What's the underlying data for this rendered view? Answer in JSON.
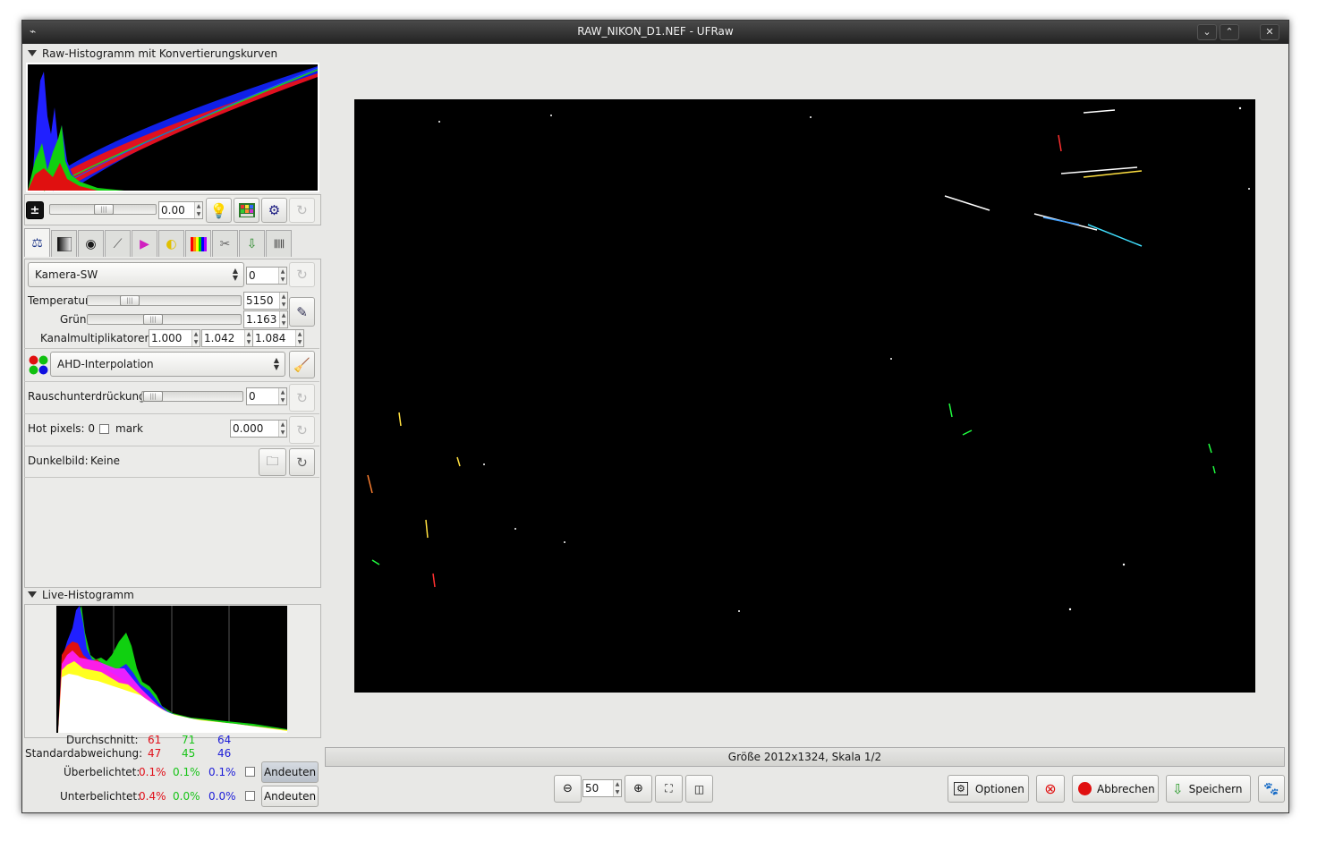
{
  "window": {
    "title": "RAW_NIKON_D1.NEF - UFRaw",
    "menu_icon": "window-menu-icon",
    "controls": [
      "minimize-icon",
      "maximize-icon",
      "close-icon"
    ],
    "minimize_glyph": "⌄",
    "maximize_glyph": "⌃",
    "close_glyph": "✕"
  },
  "raw_histogram": {
    "header": "Raw-Histogramm mit Konvertierungskurven"
  },
  "exposure": {
    "value": "0.00",
    "icon": "exposure-plus-minus-icon",
    "buttons": [
      "auto-exposure-bulb-icon",
      "color-checker-icon",
      "gear-settings-icon",
      "reset-icon"
    ]
  },
  "tabs": [
    {
      "name": "tab-white-balance",
      "icon": "white-balance-icon"
    },
    {
      "name": "tab-grayscale",
      "icon": "grayscale-icon"
    },
    {
      "name": "tab-lens",
      "icon": "lens-icon"
    },
    {
      "name": "tab-base-curve",
      "icon": "base-curve-icon"
    },
    {
      "name": "tab-color-management",
      "icon": "color-management-icon"
    },
    {
      "name": "tab-corrections",
      "icon": "corrections-icon"
    },
    {
      "name": "tab-lightness",
      "icon": "lightness-hue-icon"
    },
    {
      "name": "tab-crop-rotate",
      "icon": "crop-icon"
    },
    {
      "name": "tab-save",
      "icon": "save-settings-icon"
    },
    {
      "name": "tab-exif",
      "icon": "exif-barcode-icon"
    }
  ],
  "white_balance": {
    "preset": "Kamera-SW",
    "fine_tune": "0",
    "temperature_label": "Temperatur",
    "temperature_value": "5150",
    "temperature_level": 0.27,
    "green_label": "Grün",
    "green_value": "1.163",
    "green_level": 0.43,
    "multipliers_label": "Kanalmultiplikatoren:",
    "multipliers": [
      "1.000",
      "1.042",
      "1.084"
    ]
  },
  "interpolation": {
    "value": "AHD-Interpolation"
  },
  "noise": {
    "label": "Rauschunterdrückung",
    "value": "0",
    "level": 0.0
  },
  "hot_pixels": {
    "label": "Hot pixels: 0",
    "mark_label": "mark",
    "value": "0.000"
  },
  "dark_frame": {
    "label": "Dunkelbild:",
    "value": "Keine"
  },
  "live_histogram": {
    "header": "Live-Histogramm",
    "average_label": "Durchschnitt:",
    "average": [
      "61",
      "71",
      "64"
    ],
    "stddev_label": "Standardabweichung:",
    "stddev": [
      "47",
      "45",
      "46"
    ],
    "over_label": "Überbelichtet:",
    "over": [
      "0.1%",
      "0.1%",
      "0.1%"
    ],
    "under_label": "Unterbelichtet:",
    "under": [
      "0.4%",
      "0.0%",
      "0.0%"
    ],
    "indicate_label": "Andeuten"
  },
  "status": {
    "text": "Größe 2012x1324, Skala 1/2"
  },
  "zoom": {
    "value": "50"
  },
  "bottom_buttons": {
    "options": "Optionen",
    "cancel": "Abbrechen",
    "save": "Speichern"
  },
  "colors": {
    "red": "#e0101a",
    "green": "#18c418",
    "blue": "#1d1dd8"
  }
}
